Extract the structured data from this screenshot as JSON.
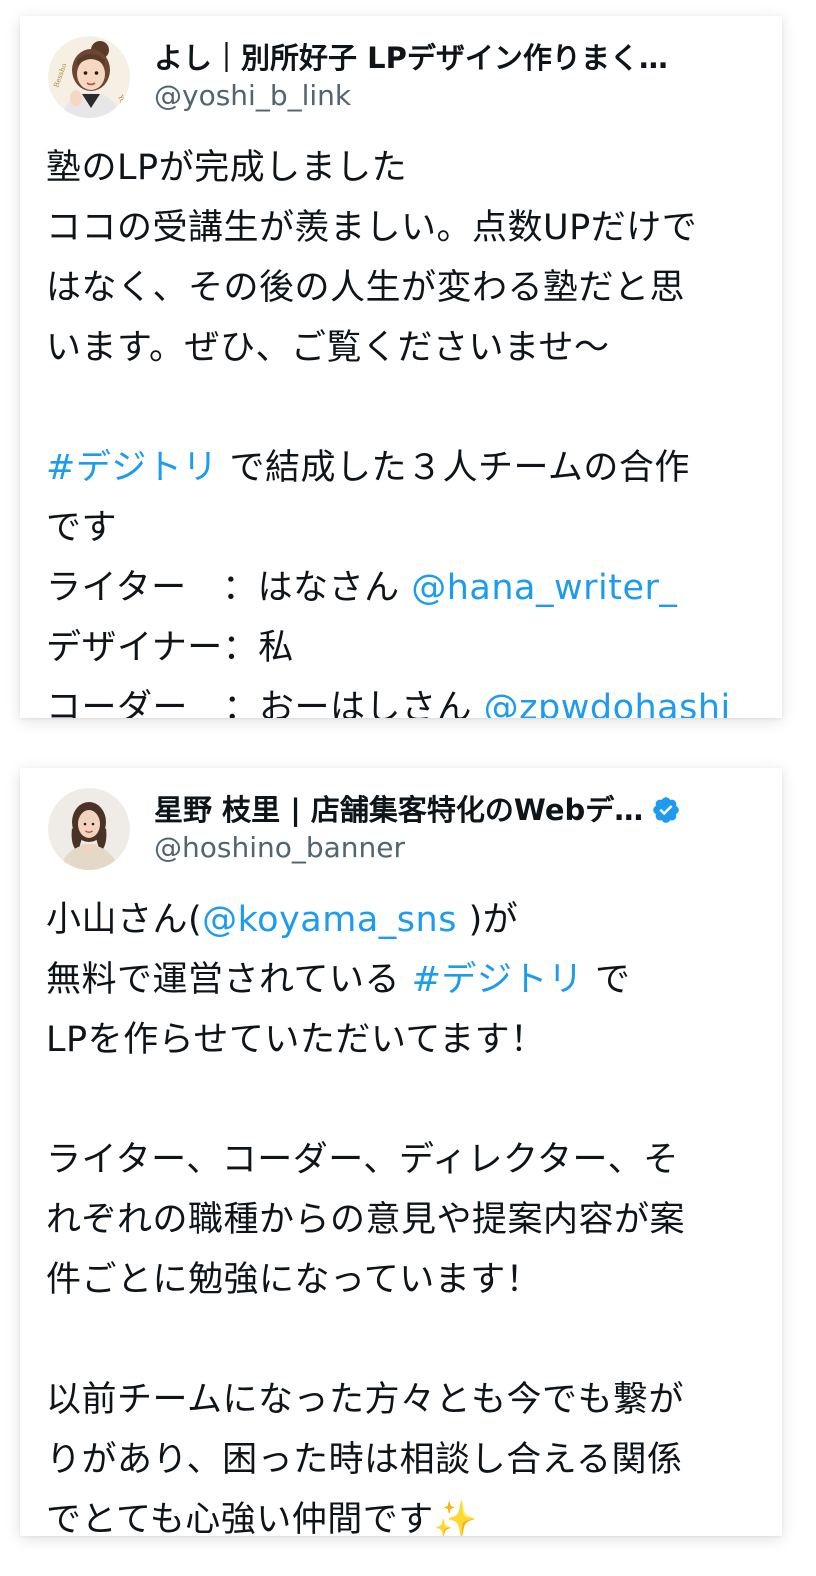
{
  "tweets": [
    {
      "display_name": "よし｜別所好子 LPデザイン作りまく…",
      "handle": "@yoshi_b_link",
      "avatar_icon": "illustrated-woman-avatar-icon",
      "lines": [
        {
          "t1": "塾のLPが完成しました"
        },
        {
          "t1": "ココの受講生が羨ましい。点数UPだけで"
        },
        {
          "t1": "はなく、その後の人生が変わる塾だと思"
        },
        {
          "t1": "います。ぜひ、ご覧くださいませ〜"
        },
        {
          "hashtag": "#デジトリ",
          "t2": " で結成した３人チームの合作"
        },
        {
          "t1": "です"
        },
        {
          "t1": "ライター　：はなさん ",
          "mention": "@hana_writer_"
        },
        {
          "t1": "デザイナー：私"
        },
        {
          "t1": "コーダー　：おーはしさん ",
          "mention": "@zpwdohashi"
        }
      ]
    },
    {
      "display_name": "星野 枝里 | 店舗集客特化のWebデ…",
      "handle": "@hoshino_banner",
      "avatar_icon": "photo-woman-avatar-icon",
      "verified_icon": "verified-badge-icon",
      "lines": [
        {
          "t1": "小山さん(",
          "mention": "@koyama_sns",
          "t2": " )が"
        },
        {
          "t1": "無料で運営されている ",
          "hashtag": "#デジトリ",
          "t2": " で"
        },
        {
          "t1": "LPを作らせていただいてます！"
        },
        {
          "t1": "ライター、コーダー、ディレクター、そ"
        },
        {
          "t1": "れぞれの職種からの意見や提案内容が案"
        },
        {
          "t1": "件ごとに勉強になっています！"
        },
        {
          "t1": "以前チームになった方々とも今でも繋が"
        },
        {
          "t1": "りがあり、困った時は相談し合える関係"
        },
        {
          "t1": "でとても心強い仲間です",
          "emoji": "✨"
        }
      ]
    }
  ],
  "colors": {
    "text": "#0f1419",
    "secondary": "#536471",
    "link": "#1d9bf0"
  }
}
